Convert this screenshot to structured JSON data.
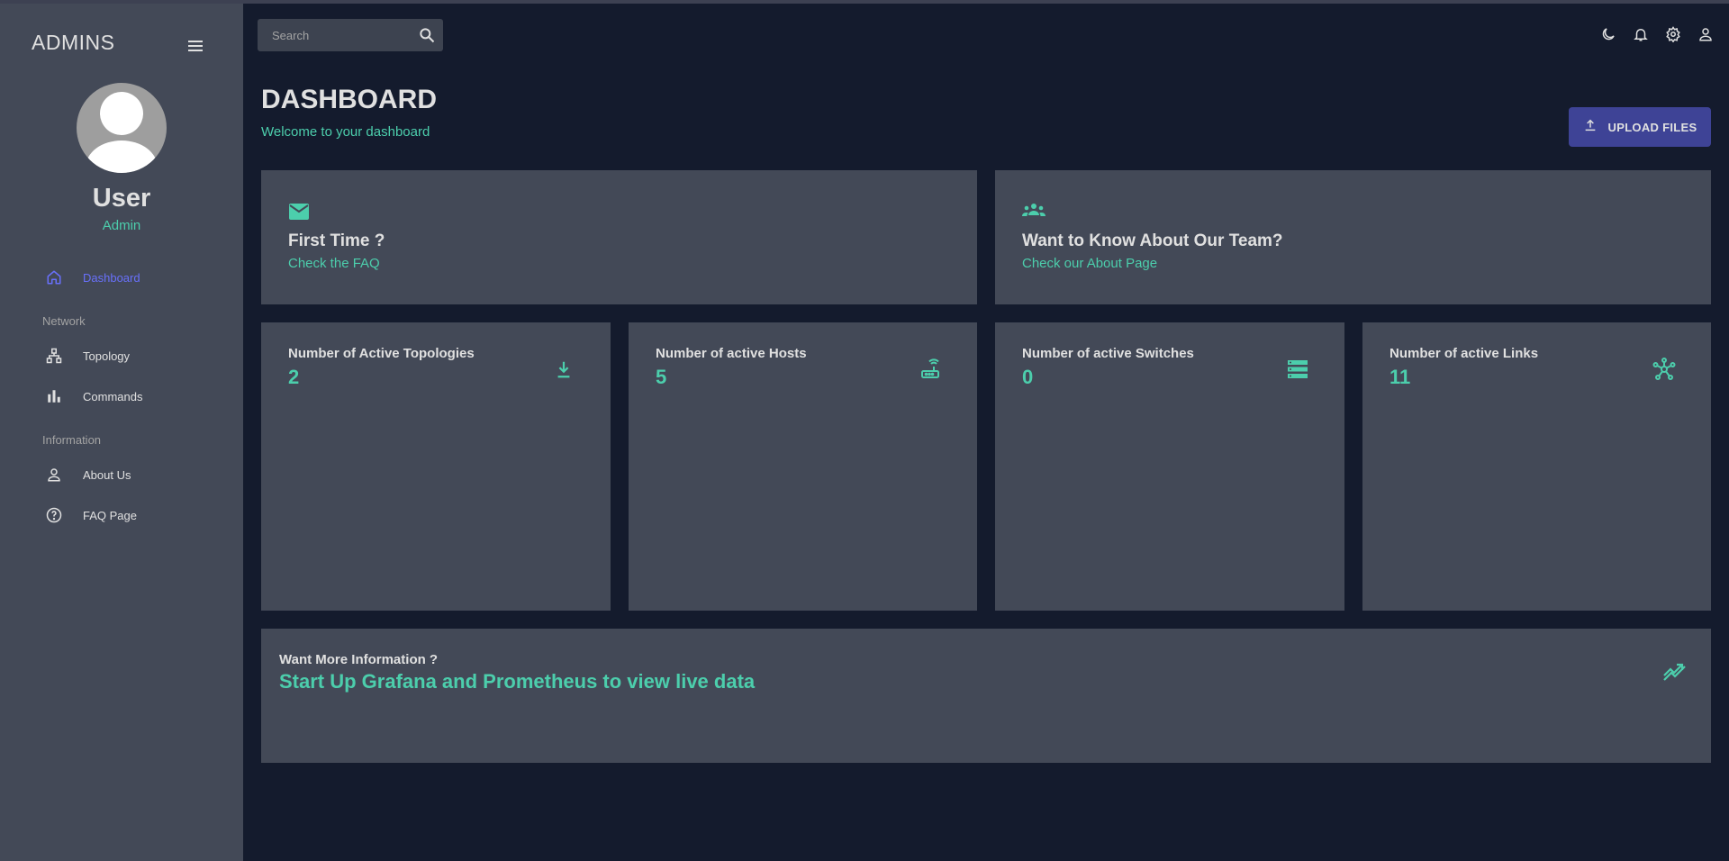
{
  "sidebar": {
    "brand": "ADMINS",
    "user": {
      "name": "User",
      "role": "Admin"
    },
    "sections": {
      "network": "Network",
      "information": "Information"
    },
    "items": [
      {
        "label": "Dashboard",
        "icon": "home-icon",
        "active": true
      },
      {
        "label": "Topology",
        "icon": "topology-icon"
      },
      {
        "label": "Commands",
        "icon": "bar-chart-icon"
      },
      {
        "label": "About Us",
        "icon": "person-icon"
      },
      {
        "label": "FAQ Page",
        "icon": "help-circle-icon"
      }
    ]
  },
  "topbar": {
    "search_placeholder": "Search",
    "icons": [
      "dark-mode-icon",
      "notifications-icon",
      "settings-icon",
      "profile-icon"
    ]
  },
  "header": {
    "title": "DASHBOARD",
    "subtitle": "Welcome to your dashboard",
    "upload_label": "UPLOAD FILES"
  },
  "info_cards": [
    {
      "title": "First Time ?",
      "link": "Check the FAQ",
      "icon": "mail-icon"
    },
    {
      "title": "Want to Know About Our Team?",
      "link": "Check our About Page",
      "icon": "groups-icon"
    }
  ],
  "stats": [
    {
      "title": "Number of Active Topologies",
      "value": "2",
      "icon": "download-icon"
    },
    {
      "title": "Number of active Hosts",
      "value": "5",
      "icon": "router-icon"
    },
    {
      "title": "Number of active Switches",
      "value": "0",
      "icon": "storage-icon"
    },
    {
      "title": "Number of active Links",
      "value": "11",
      "icon": "hub-icon"
    }
  ],
  "more": {
    "title": "Want More Information ?",
    "headline": "Start Up Grafana and Prometheus to view live data",
    "icon": "trending-icon"
  },
  "colors": {
    "background": "#141b2d",
    "panel": "#434957",
    "accent_green": "#4cceac",
    "accent_blue": "#6870fa",
    "button": "#3e4396"
  }
}
